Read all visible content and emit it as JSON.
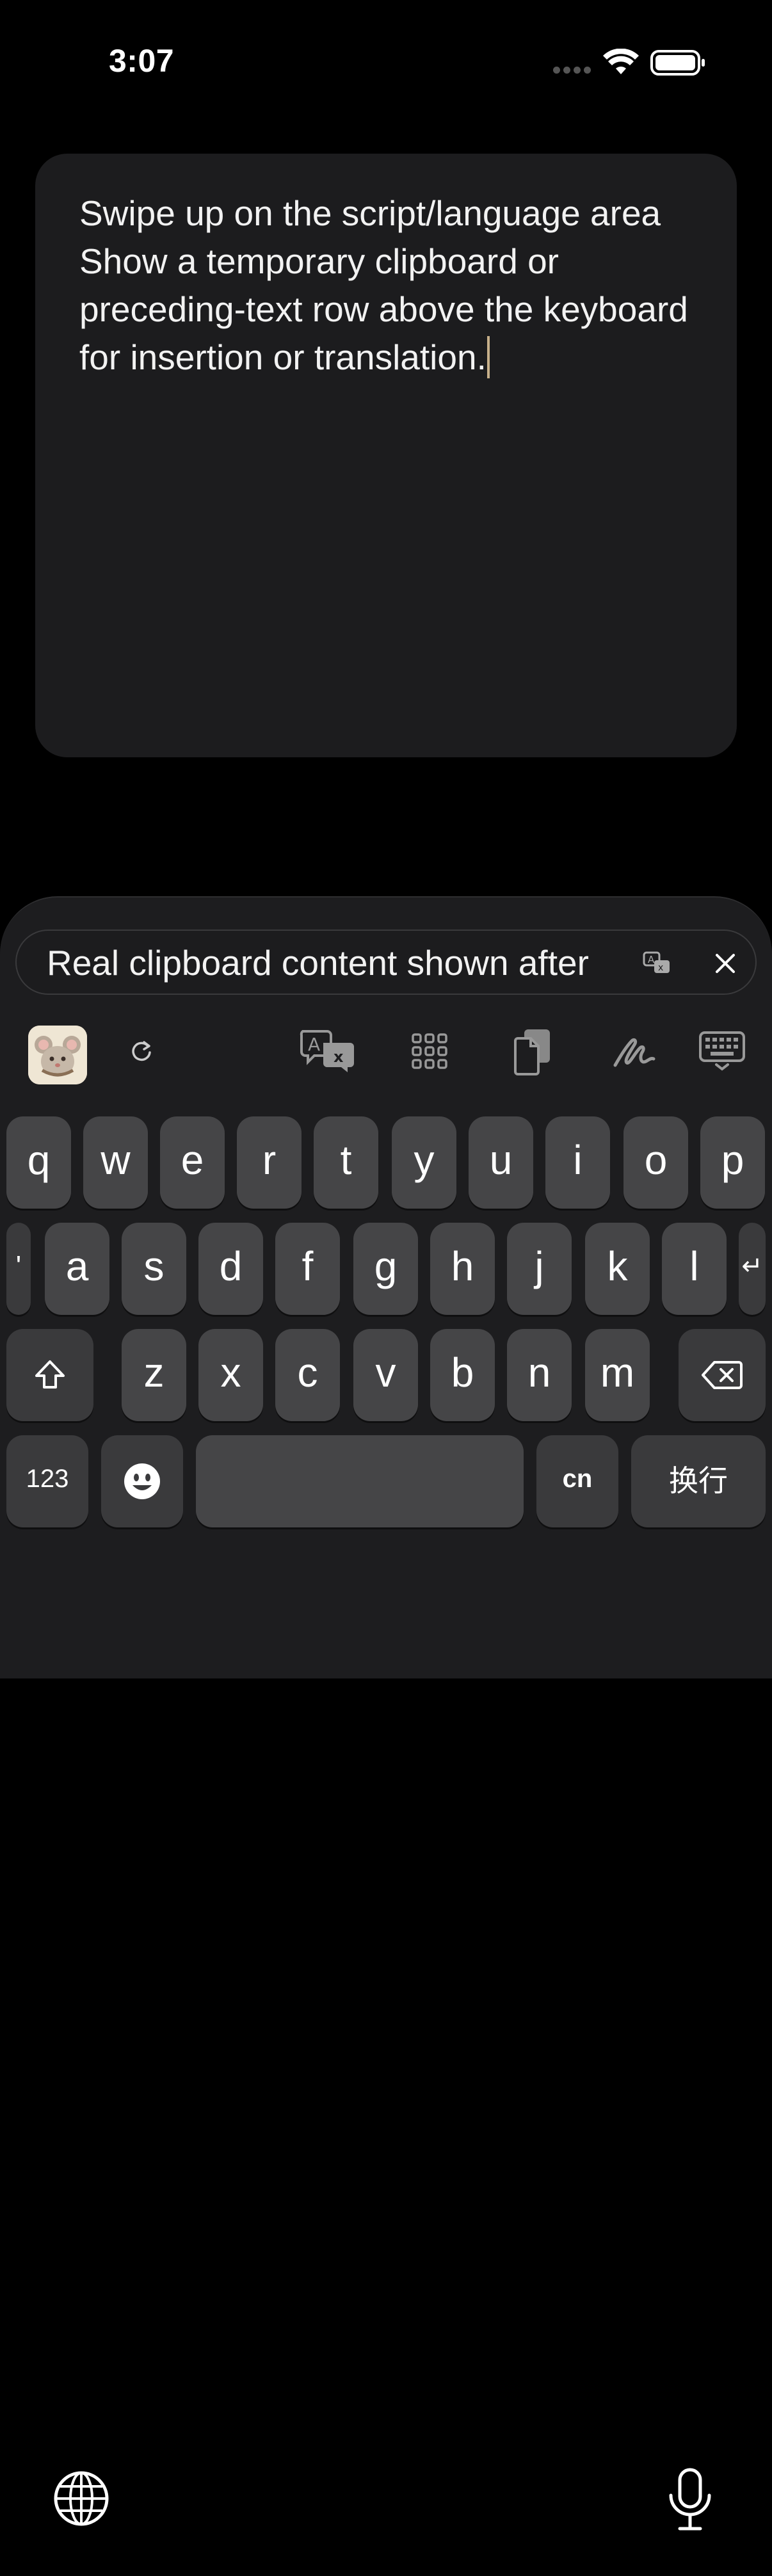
{
  "status_bar": {
    "time": "3:07",
    "icons": [
      "cellular-dots-icon",
      "wifi-icon",
      "battery-icon"
    ]
  },
  "note": {
    "text": "Swipe up on the script/language area\nShow a temporary clipboard or preceding-text row above the keyboard for insertion or translation."
  },
  "keyboard": {
    "clipboard_row": {
      "text": "Real clipboard content shown after",
      "translate_icon": "translate-icon",
      "close_icon": "close-icon"
    },
    "toolbar": {
      "items": [
        "app-logo",
        "refresh-icon",
        "translate-icon",
        "grid-icon",
        "clipboard-icon",
        "handwriting-icon",
        "keyboard-hide-icon"
      ]
    },
    "rows": {
      "row1": [
        "q",
        "w",
        "e",
        "r",
        "t",
        "y",
        "u",
        "i",
        "o",
        "p"
      ],
      "row2": [
        "'",
        "a",
        "s",
        "d",
        "f",
        "g",
        "h",
        "j",
        "k",
        "l",
        "↵"
      ],
      "row3": [
        "z",
        "x",
        "c",
        "v",
        "b",
        "n",
        "m"
      ]
    },
    "keys": {
      "numbers": "123",
      "emoji": "emoji-icon",
      "space": "",
      "language": "cn",
      "return": "换行",
      "shift": "shift-icon",
      "delete": "delete-icon"
    },
    "bottom": {
      "globe": "globe-icon",
      "mic": "microphone-icon"
    },
    "colors": {
      "background": "#1d1d1f",
      "key": "#454547",
      "caret": "#c7b08a"
    }
  }
}
